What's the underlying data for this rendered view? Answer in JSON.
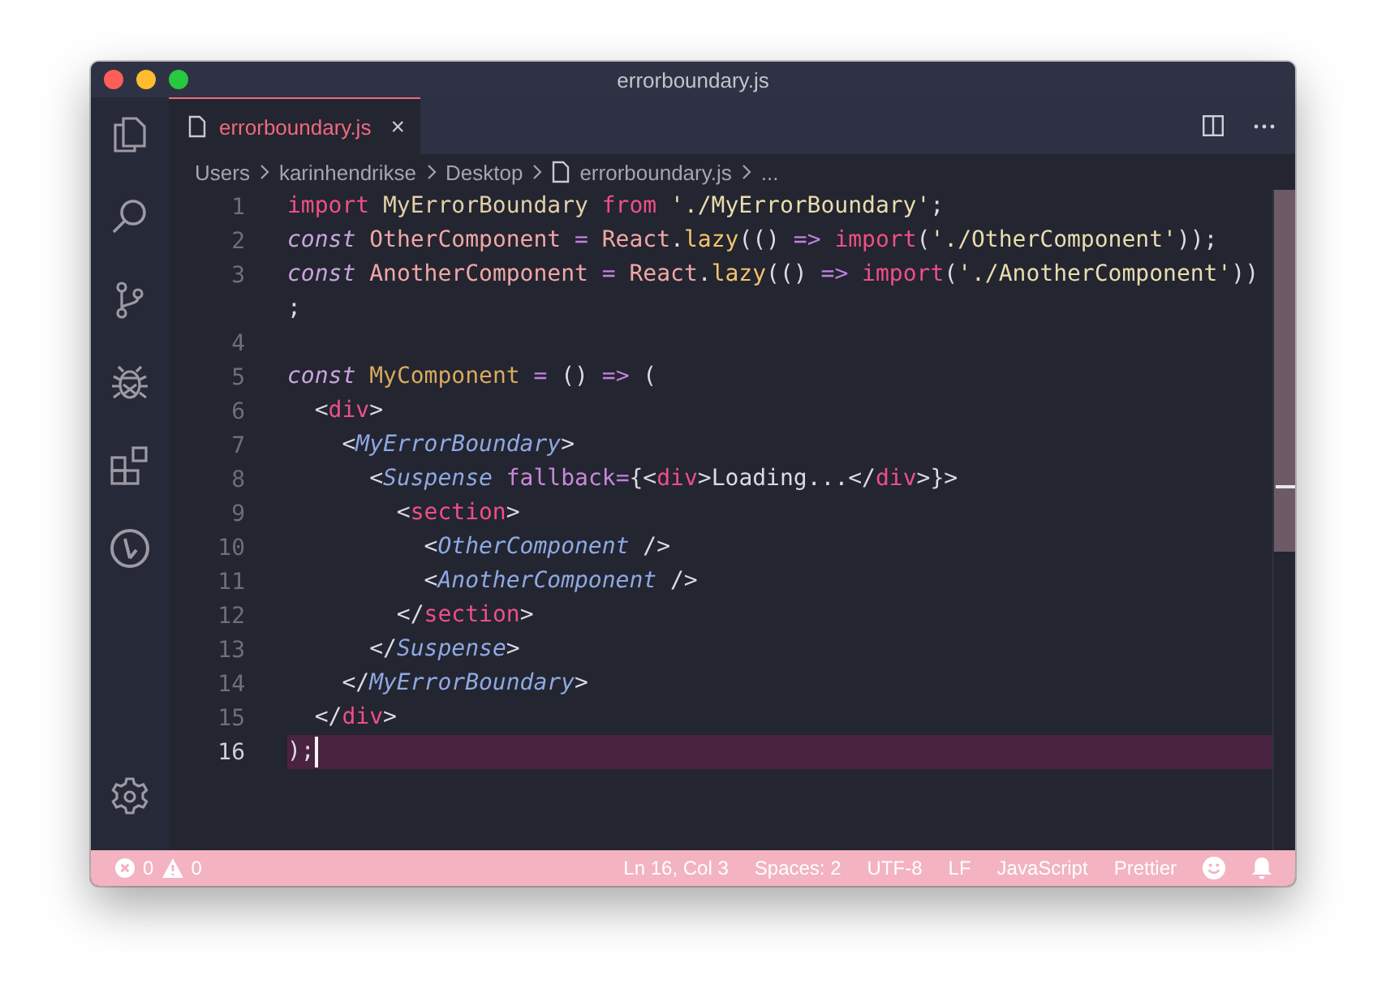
{
  "window": {
    "title": "errorboundary.js"
  },
  "activity_bar": {
    "items": [
      {
        "kind": "files"
      },
      {
        "kind": "search"
      },
      {
        "kind": "source-control"
      },
      {
        "kind": "debug"
      },
      {
        "kind": "extensions"
      },
      {
        "kind": "timeline"
      }
    ],
    "bottom": [
      {
        "kind": "settings"
      }
    ]
  },
  "tabs": [
    {
      "label": "errorboundary.js",
      "selected": true,
      "close": "×"
    }
  ],
  "breadcrumbs": [
    {
      "text": "Users",
      "kind": "folder"
    },
    {
      "text": "karinhendrikse",
      "kind": "folder"
    },
    {
      "text": "Desktop",
      "kind": "folder"
    },
    {
      "text": "errorboundary.js",
      "kind": "file"
    },
    {
      "text": "...",
      "kind": "more"
    }
  ],
  "editor": {
    "lines": [
      {
        "number": "1",
        "current": false,
        "tokens": [
          {
            "kind": "keyword",
            "text": "import"
          },
          {
            "kind": "name",
            "text": " MyErrorBoundary "
          },
          {
            "kind": "keyword",
            "text": "from"
          },
          {
            "kind": "string",
            "text": " './MyErrorBoundary'"
          },
          {
            "kind": "plain",
            "text": ";"
          }
        ]
      },
      {
        "number": "2",
        "current": false,
        "tokens": [
          {
            "kind": "storage",
            "text": "const"
          },
          {
            "kind": "variable",
            "text": " OtherComponent "
          },
          {
            "kind": "operator",
            "text": "="
          },
          {
            "kind": "variable",
            "text": " React"
          },
          {
            "kind": "plain",
            "text": "."
          },
          {
            "kind": "function",
            "text": "lazy"
          },
          {
            "kind": "plain",
            "text": "(() "
          },
          {
            "kind": "operator",
            "text": "=>"
          },
          {
            "kind": "keyword",
            "text": " import"
          },
          {
            "kind": "plain",
            "text": "("
          },
          {
            "kind": "string",
            "text": "'./OtherComponent'"
          },
          {
            "kind": "plain",
            "text": "));"
          }
        ]
      },
      {
        "number": "3",
        "current": false,
        "tokens": [
          {
            "kind": "storage",
            "text": "const"
          },
          {
            "kind": "variable",
            "text": " AnotherComponent "
          },
          {
            "kind": "operator",
            "text": "="
          },
          {
            "kind": "variable",
            "text": " React"
          },
          {
            "kind": "plain",
            "text": "."
          },
          {
            "kind": "function",
            "text": "lazy"
          },
          {
            "kind": "plain",
            "text": "(() "
          },
          {
            "kind": "operator",
            "text": "=>"
          },
          {
            "kind": "keyword",
            "text": " import"
          },
          {
            "kind": "plain",
            "text": "("
          },
          {
            "kind": "string",
            "text": "'./AnotherComponent'"
          },
          {
            "kind": "plain",
            "text": "))"
          }
        ],
        "wrapped": [
          {
            "kind": "plain",
            "text": ";"
          }
        ]
      },
      {
        "number": "4",
        "current": false
      },
      {
        "number": "5",
        "current": false,
        "tokens": [
          {
            "kind": "storage",
            "text": "const"
          },
          {
            "kind": "title",
            "text": " MyComponent "
          },
          {
            "kind": "operator",
            "text": "="
          },
          {
            "kind": "plain",
            "text": " () "
          },
          {
            "kind": "operator",
            "text": "=>"
          },
          {
            "kind": "plain",
            "text": " ("
          }
        ]
      },
      {
        "number": "6",
        "current": false,
        "tokens": [
          {
            "kind": "plain",
            "text": "  <"
          },
          {
            "kind": "tag",
            "text": "div"
          },
          {
            "kind": "plain",
            "text": ">"
          }
        ]
      },
      {
        "number": "7",
        "current": false,
        "tokens": [
          {
            "kind": "plain",
            "text": "    <"
          },
          {
            "kind": "component",
            "text": "MyErrorBoundary"
          },
          {
            "kind": "plain",
            "text": ">"
          }
        ]
      },
      {
        "number": "8",
        "current": false,
        "tokens": [
          {
            "kind": "plain",
            "text": "      <"
          },
          {
            "kind": "component",
            "text": "Suspense"
          },
          {
            "kind": "attribute",
            "text": " fallback"
          },
          {
            "kind": "operator",
            "text": "="
          },
          {
            "kind": "plain",
            "text": "{<"
          },
          {
            "kind": "tag",
            "text": "div"
          },
          {
            "kind": "plain",
            "text": ">Loading...</"
          },
          {
            "kind": "tag",
            "text": "div"
          },
          {
            "kind": "plain",
            "text": ">}>"
          }
        ]
      },
      {
        "number": "9",
        "current": false,
        "tokens": [
          {
            "kind": "plain",
            "text": "        <"
          },
          {
            "kind": "tag",
            "text": "section"
          },
          {
            "kind": "plain",
            "text": ">"
          }
        ]
      },
      {
        "number": "10",
        "current": false,
        "tokens": [
          {
            "kind": "plain",
            "text": "          <"
          },
          {
            "kind": "component",
            "text": "OtherComponent"
          },
          {
            "kind": "plain",
            "text": " />"
          }
        ]
      },
      {
        "number": "11",
        "current": false,
        "tokens": [
          {
            "kind": "plain",
            "text": "          <"
          },
          {
            "kind": "component",
            "text": "AnotherComponent"
          },
          {
            "kind": "plain",
            "text": " />"
          }
        ]
      },
      {
        "number": "12",
        "current": false,
        "tokens": [
          {
            "kind": "plain",
            "text": "        </"
          },
          {
            "kind": "tag",
            "text": "section"
          },
          {
            "kind": "plain",
            "text": ">"
          }
        ]
      },
      {
        "number": "13",
        "current": false,
        "tokens": [
          {
            "kind": "plain",
            "text": "      </"
          },
          {
            "kind": "component",
            "text": "Suspense"
          },
          {
            "kind": "plain",
            "text": ">"
          }
        ]
      },
      {
        "number": "14",
        "current": false,
        "tokens": [
          {
            "kind": "plain",
            "text": "    </"
          },
          {
            "kind": "component",
            "text": "MyErrorBoundary"
          },
          {
            "kind": "plain",
            "text": ">"
          }
        ]
      },
      {
        "number": "15",
        "current": false,
        "tokens": [
          {
            "kind": "plain",
            "text": "  </"
          },
          {
            "kind": "tag",
            "text": "div"
          },
          {
            "kind": "plain",
            "text": ">"
          }
        ]
      },
      {
        "number": "16",
        "current": true,
        "tokens": [
          {
            "kind": "plain",
            "text": ");"
          }
        ]
      }
    ]
  },
  "status_bar": {
    "errors": "0",
    "warnings": "0",
    "items": [
      {
        "kind": "text",
        "text": "Ln 16, Col 3"
      },
      {
        "kind": "text",
        "text": "Spaces: 2"
      },
      {
        "kind": "text",
        "text": "UTF-8"
      },
      {
        "kind": "text",
        "text": "LF"
      },
      {
        "kind": "text",
        "text": "JavaScript"
      },
      {
        "kind": "text",
        "text": "Prettier"
      },
      {
        "kind": "feedback"
      },
      {
        "kind": "notifications"
      }
    ]
  }
}
